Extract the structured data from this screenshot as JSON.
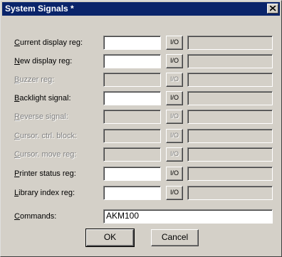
{
  "window": {
    "title": "System Signals *"
  },
  "io_label": "I/O",
  "rows": [
    {
      "label_key": "C",
      "label_rest": "urrent display reg:",
      "enabled": true,
      "value": "",
      "extra": ""
    },
    {
      "label_key": "N",
      "label_rest": "ew display reg:",
      "enabled": true,
      "value": "",
      "extra": ""
    },
    {
      "label_key": "B",
      "label_rest": "uzzer reg:",
      "enabled": false,
      "value": "",
      "extra": ""
    },
    {
      "label_key": "B",
      "label_rest": "acklight signal:",
      "enabled": true,
      "value": "",
      "extra": ""
    },
    {
      "label_key": "R",
      "label_rest": "everse signal:",
      "enabled": false,
      "value": "",
      "extra": ""
    },
    {
      "label_key": "C",
      "label_rest": "ursor. ctrl. block:",
      "enabled": false,
      "value": "",
      "extra": ""
    },
    {
      "label_key": "C",
      "label_rest": "ursor. move reg:",
      "enabled": false,
      "value": "",
      "extra": ""
    },
    {
      "label_key": "P",
      "label_rest": "rinter status reg:",
      "enabled": true,
      "value": "",
      "extra": ""
    },
    {
      "label_key": "L",
      "label_rest": "ibrary index reg:",
      "enabled": true,
      "value": "",
      "extra": ""
    }
  ],
  "commands": {
    "label_key": "C",
    "label_rest": "ommands:",
    "value": "AKM100"
  },
  "buttons": {
    "ok": "OK",
    "cancel": "Cancel"
  }
}
